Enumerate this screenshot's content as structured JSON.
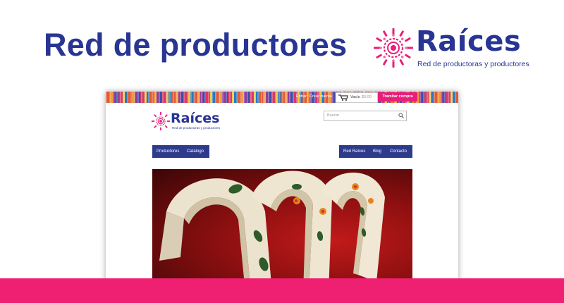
{
  "header": {
    "title": "Red de productores"
  },
  "brand": {
    "name": "Raíces",
    "tagline": "Red de productoras y productores",
    "colors": {
      "primary": "#283593",
      "accent": "#e91e7a"
    }
  },
  "screenshot": {
    "topbar": {
      "links": [
        "Entrar",
        "Crear cuenta"
      ],
      "cart_label": "Vacío",
      "cart_amount": "$0.00",
      "checkout_label": "Tramitar compra"
    },
    "site_logo": {
      "name": "Raíces",
      "tagline": "Red de productoras y productores"
    },
    "search": {
      "placeholder": "Buscar"
    },
    "nav_left": [
      "Productores",
      "Catálogo"
    ],
    "nav_right": [
      "Red Raíces",
      "Blog",
      "Contacto"
    ],
    "hero": {
      "image": "embroidered-headbands-photo"
    }
  },
  "footer_band": {
    "color": "#ef1f72"
  }
}
